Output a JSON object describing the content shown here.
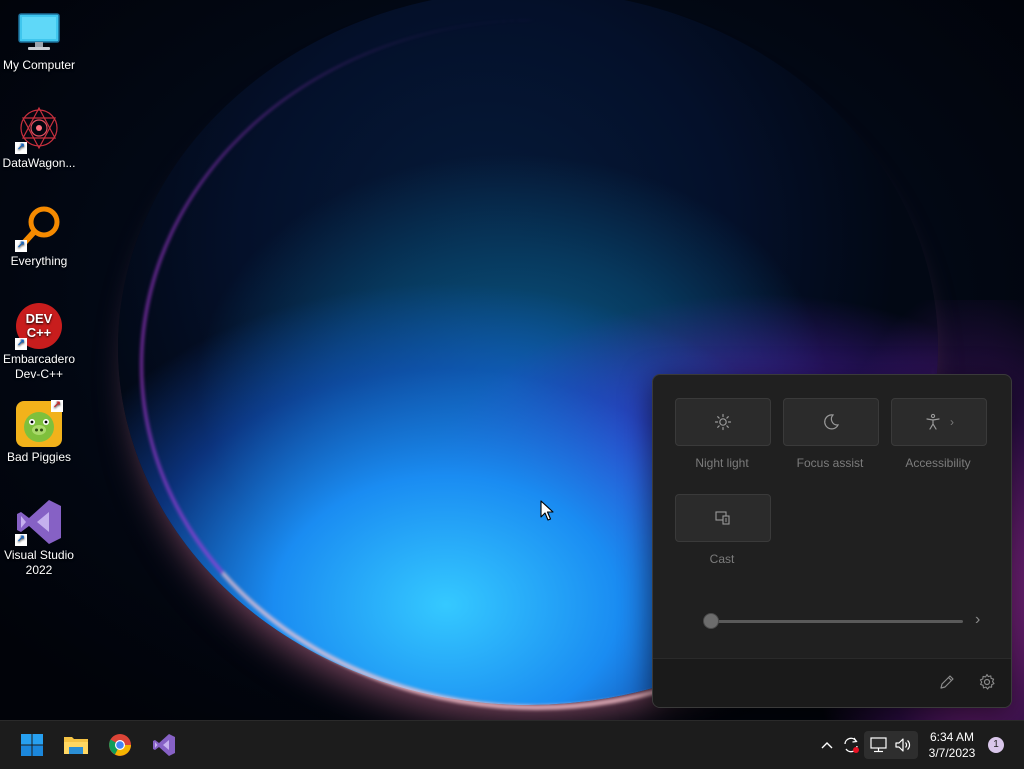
{
  "desktop": {
    "icons": [
      {
        "label": "My Computer",
        "icon": "monitor-icon",
        "shortcut": false
      },
      {
        "label": "DataWagon...",
        "icon": "datawagon-icon",
        "shortcut": true
      },
      {
        "label": "Everything",
        "icon": "magnifier-icon",
        "shortcut": true
      },
      {
        "label": "Embarcadero Dev-C++",
        "icon": "devcpp-icon",
        "shortcut": true,
        "logo_text": "DEV C++"
      },
      {
        "label": "Bad Piggies",
        "icon": "bad-piggies-icon",
        "shortcut": true
      },
      {
        "label": "Visual Studio 2022",
        "icon": "visual-studio-icon",
        "shortcut": true
      }
    ]
  },
  "quick_settings": {
    "tiles": [
      {
        "label": "Night light",
        "icon": "brightness-icon"
      },
      {
        "label": "Focus assist",
        "icon": "moon-icon"
      },
      {
        "label": "Accessibility",
        "icon": "accessibility-icon"
      },
      {
        "label": "Cast",
        "icon": "cast-icon"
      }
    ],
    "brightness_level": 0,
    "footer": {
      "edit_icon": "pencil-icon",
      "settings_icon": "gear-icon"
    }
  },
  "taskbar": {
    "pinned": [
      "start-icon",
      "file-explorer-icon",
      "chrome-icon",
      "visual-studio-icon"
    ],
    "tray": [
      "chevron-up-icon",
      "sync-icon",
      "network-icon",
      "volume-icon"
    ],
    "time": "6:34 AM",
    "date": "3/7/2023",
    "notification_count": "1"
  },
  "colors": {
    "accent": "#0078d4",
    "panel_bg": "#202020",
    "taskbar_bg": "#1c1c1c"
  }
}
